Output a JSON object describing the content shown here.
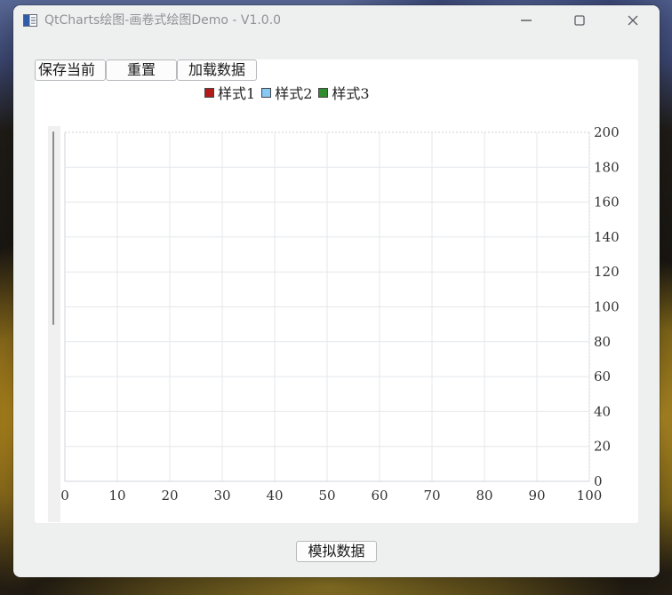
{
  "window": {
    "title": "QtCharts绘图-画卷式绘图Demo - V1.0.0"
  },
  "titlebar": {
    "icons": {
      "app": "app-window-icon",
      "minimize": "minimize-icon",
      "maximize": "maximize-icon",
      "close": "close-icon"
    }
  },
  "toolbar": {
    "save_label": "保存当前",
    "reset_label": "重置",
    "load_label": "加载数据"
  },
  "bottom": {
    "simulate_label": "模拟数据"
  },
  "legend": [
    {
      "label": "样式1",
      "color": "#b31b1b"
    },
    {
      "label": "样式2",
      "color": "#87c8f4"
    },
    {
      "label": "样式3",
      "color": "#2f8d2f"
    }
  ],
  "chart_data": {
    "type": "line",
    "series": [
      {
        "name": "样式1",
        "values": []
      },
      {
        "name": "样式2",
        "values": []
      },
      {
        "name": "样式3",
        "values": []
      }
    ],
    "x": [],
    "xticks": [
      "0",
      "10",
      "20",
      "30",
      "40",
      "50",
      "60",
      "70",
      "80",
      "90",
      "100"
    ],
    "yticks": [
      "0",
      "20",
      "40",
      "60",
      "80",
      "100",
      "120",
      "140",
      "160",
      "180",
      "200"
    ],
    "xlim": [
      0,
      100
    ],
    "ylim": [
      0,
      200
    ],
    "grid": true,
    "legend_position": "top-center",
    "y_axis_side": "right"
  }
}
